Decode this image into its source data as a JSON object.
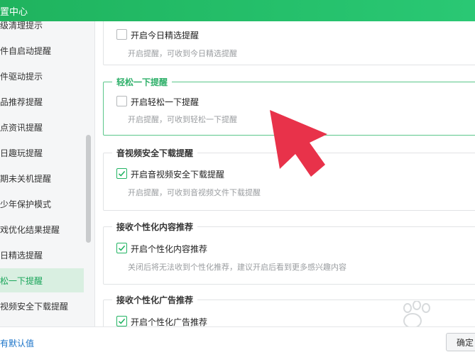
{
  "window": {
    "title": "置中心"
  },
  "sidebar": {
    "items": [
      {
        "label": "级清理提示"
      },
      {
        "label": "件自启动提醒"
      },
      {
        "label": "件驱动提示"
      },
      {
        "label": "品推荐提醒"
      },
      {
        "label": "点资讯提醒"
      },
      {
        "label": "日趣玩提醒"
      },
      {
        "label": "期未关机提醒"
      },
      {
        "label": "少年保护模式"
      },
      {
        "label": "戏优化结果提醒"
      },
      {
        "label": "日精选提醒"
      },
      {
        "label": "松一下提醒",
        "active": true
      },
      {
        "label": "视频安全下载提醒"
      }
    ]
  },
  "groups": [
    {
      "title": "",
      "checkbox_label": "开启今日精选提醒",
      "checked": false,
      "description": "开启提醒，可收到今日精选提醒"
    },
    {
      "title": "轻松一下提醒",
      "checkbox_label": "开启轻松一下提醒",
      "checked": false,
      "description": "开启提醒，可收到轻松一下提醒",
      "highlighted": true
    },
    {
      "title": "音视频安全下载提醒",
      "checkbox_label": "开启音视频安全下载提醒",
      "checked": true,
      "description": "开启提醒，可收到音视频文件下载提醒"
    },
    {
      "title": "接收个性化内容推荐",
      "checkbox_label": "开启个性化内容推荐",
      "checked": true,
      "description": "关闭后将无法收到个性化推荐，建议开启后看到更多感兴趣内容"
    },
    {
      "title": "接收个性化广告推荐",
      "checkbox_label": "开启个性化广告推荐",
      "checked": true,
      "description": ""
    }
  ],
  "footer": {
    "restore_link": "有默认值",
    "ok_label": "确定"
  },
  "colors": {
    "brand_green": "#22b463",
    "arrow_red": "#e8324a",
    "link_blue": "#1a73c8"
  }
}
